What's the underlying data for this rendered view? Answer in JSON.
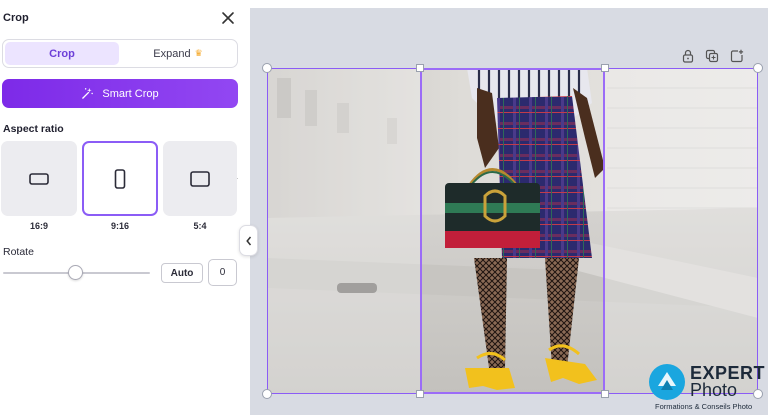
{
  "panel": {
    "title": "Crop",
    "tabs": [
      {
        "label": "Crop",
        "active": true
      },
      {
        "label": "Expand",
        "active": false,
        "badge_icon": "crown-icon"
      }
    ],
    "smart_crop_label": "Smart Crop",
    "aspect_ratio_label": "Aspect ratio",
    "ratios": [
      {
        "label": "16:9",
        "selected": false
      },
      {
        "label": "9:16",
        "selected": true
      },
      {
        "label": "5:4",
        "selected": false
      }
    ],
    "rotate_label": "Rotate",
    "rotate_value": "0",
    "rotate_slider_fraction": 0.5,
    "auto_label": "Auto"
  },
  "colors": {
    "accent": "#8b5cf6",
    "smart_crop_bg": "#7d2ae8",
    "tab_active_bg": "#ece4ff",
    "canvas_bg": "#d8dbe3"
  },
  "watermark": {
    "line1": "EXPERT",
    "line2": "Photo",
    "line3": "Formations & Conseils Photo"
  }
}
